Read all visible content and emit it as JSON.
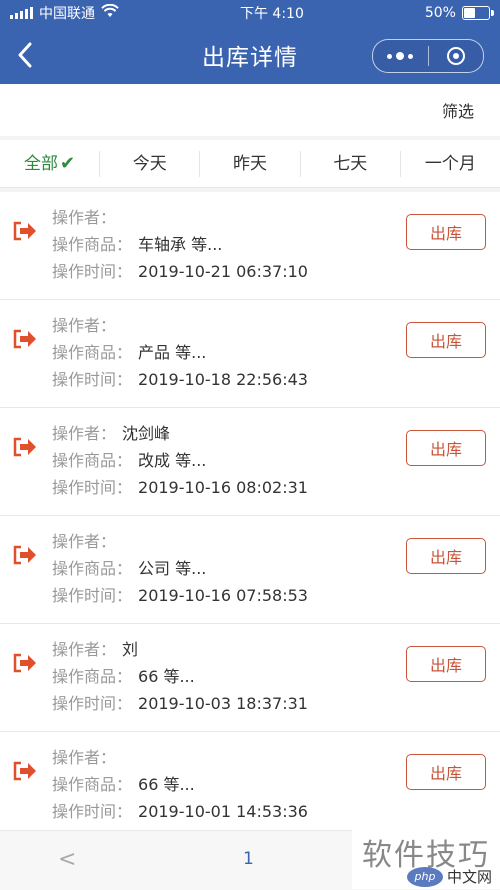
{
  "status_bar": {
    "carrier": "中国联通",
    "time": "下午 4:10",
    "battery_text": "50%",
    "battery_level": 0.5
  },
  "nav": {
    "title": "出库详情"
  },
  "filter": {
    "label": "筛选"
  },
  "tabs": [
    {
      "label": "全部",
      "active": true
    },
    {
      "label": "今天",
      "active": false
    },
    {
      "label": "昨天",
      "active": false
    },
    {
      "label": "七天",
      "active": false
    },
    {
      "label": "一个月",
      "active": false
    }
  ],
  "labels": {
    "operator": "操作者：",
    "goods": "操作商品：",
    "time": "操作时间："
  },
  "records": [
    {
      "operator": "",
      "goods": "车轴承 等...",
      "time": "2019-10-21 06:37:10",
      "button": "出库"
    },
    {
      "operator": "",
      "goods": "产品 等...",
      "time": "2019-10-18 22:56:43",
      "button": "出库"
    },
    {
      "operator": "沈剑峰",
      "goods": "改成 等...",
      "time": "2019-10-16 08:02:31",
      "button": "出库"
    },
    {
      "operator": "",
      "goods": "公司 等...",
      "time": "2019-10-16 07:58:53",
      "button": "出库"
    },
    {
      "operator": "刘",
      "goods": "66 等...",
      "time": "2019-10-03 18:37:31",
      "button": "出库"
    },
    {
      "operator": "",
      "goods": "66 等...",
      "time": "2019-10-01 14:53:36",
      "button": "出库"
    }
  ],
  "pager": {
    "prev": "<",
    "page": "1"
  },
  "watermark": {
    "text": "软件技巧",
    "logo": "php",
    "site": "中文网"
  },
  "colors": {
    "header": "#3a63b0",
    "active_tab": "#2e8b3d",
    "out_button": "#c9553a",
    "out_icon": "#e0502c"
  }
}
